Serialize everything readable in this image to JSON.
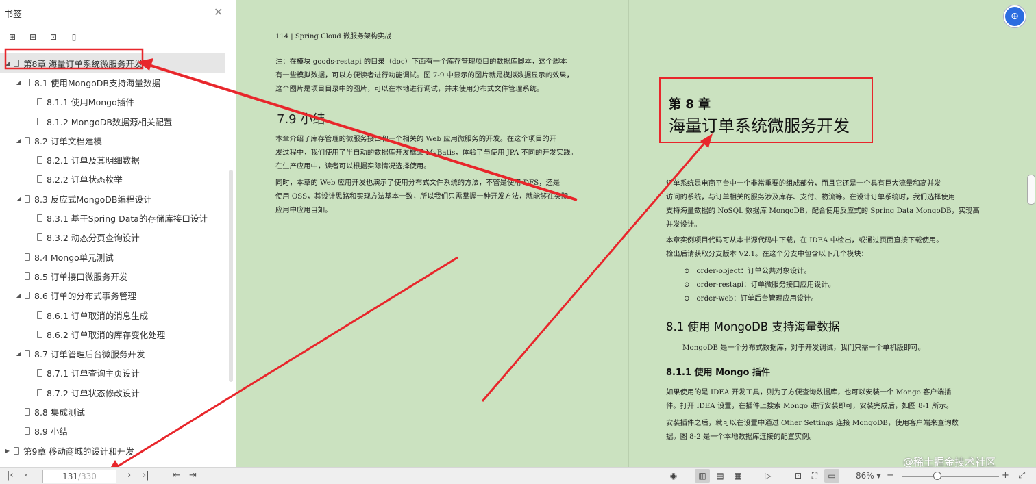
{
  "sidebar": {
    "title": "书签",
    "close_icon": "close-icon",
    "tools": [
      "expand-all-icon",
      "collapse-all-icon",
      "add-bookmark-icon",
      "bookmark-icon"
    ],
    "items": [
      {
        "label": "第8章 海量订单系统微服务开发",
        "level": 0,
        "expanded": true,
        "selected": true
      },
      {
        "label": "8.1 使用MongoDB支持海量数据",
        "level": 1,
        "expanded": true
      },
      {
        "label": "8.1.1 使用Mongo插件",
        "level": 2
      },
      {
        "label": "8.1.2 MongoDB数据源相关配置",
        "level": 2
      },
      {
        "label": "8.2 订单文档建模",
        "level": 1,
        "expanded": true
      },
      {
        "label": "8.2.1 订单及其明细数据",
        "level": 2
      },
      {
        "label": "8.2.2 订单状态枚举",
        "level": 2
      },
      {
        "label": "8.3 反应式MongoDB编程设计",
        "level": 1,
        "expanded": true
      },
      {
        "label": "8.3.1 基于Spring Data的存储库接口设计",
        "level": 2
      },
      {
        "label": "8.3.2 动态分页查询设计",
        "level": 2
      },
      {
        "label": "8.4 Mongo单元测试",
        "level": 1
      },
      {
        "label": "8.5 订单接口微服务开发",
        "level": 1
      },
      {
        "label": "8.6 订单的分布式事务管理",
        "level": 1,
        "expanded": true
      },
      {
        "label": "8.6.1 订单取消的消息生成",
        "level": 2
      },
      {
        "label": "8.6.2 订单取消的库存变化处理",
        "level": 2
      },
      {
        "label": "8.7 订单管理后台微服务开发",
        "level": 1,
        "expanded": true
      },
      {
        "label": "8.7.1 订单查询主页设计",
        "level": 2
      },
      {
        "label": "8.7.2 订单状态修改设计",
        "level": 2
      },
      {
        "label": "8.8 集成测试",
        "level": 1
      },
      {
        "label": "8.9 小结",
        "level": 1
      },
      {
        "label": "第9章 移动商城的设计和开发",
        "level": 0,
        "expanded": false
      }
    ]
  },
  "left_page": {
    "running_head": "114 | Spring Cloud 微服务架构实战",
    "note_lines": [
      "注：在模块 goods-restapi 的目录（doc）下面有一个库存管理项目的数据库脚本，这个脚本",
      "有一些模拟数据，可以方便读者进行功能调试。图 7-9 中显示的图片就是模拟数据显示的效果，",
      "这个图片是项目目录中的图片，可以在本地进行调试，并未使用分布式文件管理系统。"
    ],
    "section_heading": "7.9    小结",
    "para1_lines": [
      "本章介绍了库存管理的微服务接口和一个相关的 Web 应用微服务的开发。在这个项目的开",
      "发过程中，我们使用了半自动的数据库开发框架 MyBatis，体验了与使用 JPA 不同的开发实践。",
      "在生产应用中，读者可以根据实际情况选择使用。"
    ],
    "para2_lines": [
      "同时，本章的 Web 应用开发也演示了使用分布式文件系统的方法，不管是使用 DFS，还是",
      "使用 OSS，其设计思路和实现方法基本一致，所以我们只需掌握一种开发方法，就能够在实际",
      "应用中应用自如。"
    ]
  },
  "right_page": {
    "chapter_no": "第 8 章",
    "chapter_title": "海量订单系统微服务开发",
    "intro_lines": [
      "订单系统是电商平台中一个非常重要的组成部分，而且它还是一个具有巨大流量和高并发",
      "访问的系统，与订单相关的服务涉及库存、支付、物流等。在设计订单系统时，我们选择使用",
      "支持海量数据的 NoSQL 数据库 MongoDB，配合使用反应式的 Spring Data MongoDB，实现高",
      "并发设计。"
    ],
    "code_lines": [
      "本章实例项目代码可从本书源代码中下载，在 IDEA 中检出，或通过页面直接下载使用。",
      "检出后请获取分支版本 V2.1。在这个分支中包含以下几个模块："
    ],
    "bullets": [
      "order-object：订单公共对象设计。",
      "order-restapi：订单微服务接口应用设计。",
      "order-web：订单后台管理应用设计。"
    ],
    "section_heading": "8.1    使用 MongoDB 支持海量数据",
    "section_text": "MongoDB 是一个分布式数据库，对于开发调试，我们只需一个单机版即可。",
    "sub_heading": "8.1.1    使用 Mongo 插件",
    "sub_lines": [
      "如果使用的是 IDEA 开发工具，则为了方便查询数据库，也可以安装一个 Mongo 客户端插",
      "件。打开 IDEA 设置，在插件上搜索 Mongo 进行安装即可，安装完成后，如图 8-1 所示。"
    ],
    "sub_lines2": [
      "安装插件之后，就可以在设置中通过 Other Settings 连接 MongoDB，使用客户端来查询数",
      "据。图 8-2 是一个本地数据库连接的配置实例。"
    ]
  },
  "bottom": {
    "current_page": "131",
    "total_pages": "/330",
    "zoom": "86%",
    "zoom_level": 0.36
  },
  "watermark": "@稀土掘金技术社区",
  "colors": {
    "annotation": "#e8262b",
    "page_bg": "#cbe2c0",
    "accent": "#2c6de0"
  }
}
